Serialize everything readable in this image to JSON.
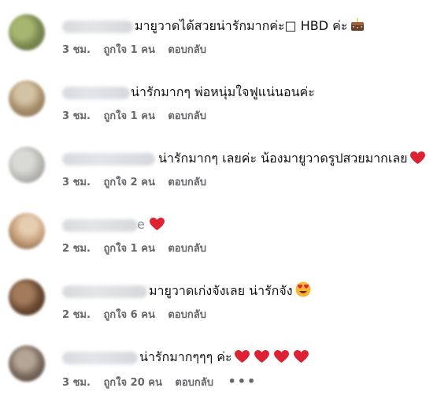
{
  "comments": [
    {
      "text": "มายูวาดได้สวยน่ารักมากค่ะ□ HBD ค่ะ",
      "emoji": "cake",
      "time": "3 ชม.",
      "likes": "ถูกใจ 1 คน",
      "reply": "ตอบกลับ",
      "avatar_colors": [
        "#7b8a52",
        "#a7b66f",
        "#55723a"
      ]
    },
    {
      "text": "น่ารักมากๆ พ่อหนุ่มใจฟูแน่นอนค่ะ",
      "emoji": "",
      "time": "3 ชม.",
      "likes": "ถูกใจ 1 คน",
      "reply": "ตอบกลับ",
      "avatar_colors": [
        "#a98f6d",
        "#d3c2a3",
        "#7f6a4f"
      ]
    },
    {
      "text": "น่ารักมากๆ เลยค่ะ น้องมายูวาดรูปสวยมากเลย",
      "emoji": "heart",
      "time": "3 ชม.",
      "likes": "ถูกใจ 2 คน",
      "reply": "ตอบกลับ",
      "avatar_colors": [
        "#b8b7b3",
        "#d9d9d6",
        "#8f8d88"
      ]
    },
    {
      "text": "e",
      "emoji": "heart",
      "time": "2 ชม.",
      "likes": "ถูกใจ 1 คน",
      "reply": "ตอบกลับ",
      "avatar_colors": [
        "#c9a27c",
        "#e6cdb1",
        "#6e5940"
      ]
    },
    {
      "text": "มายูวาดเก่งจังเลย น่ารักจัง",
      "emoji": "heart-eyes",
      "time": "2 ชม.",
      "likes": "ถูกใจ 6 คน",
      "reply": "ตอบกลับ",
      "avatar_colors": [
        "#6c4a32",
        "#a27b5c",
        "#3f2a1d"
      ]
    },
    {
      "text": "น่ารักมากๆๆๆ ค่ะ",
      "emoji": "hearts",
      "time": "3 ชม.",
      "likes": "ถูกใจ 20 คน",
      "reply": "ตอบกลับ",
      "more": "•••",
      "avatar_colors": [
        "#7a6a5d",
        "#b4a594",
        "#4a3f36"
      ]
    }
  ]
}
